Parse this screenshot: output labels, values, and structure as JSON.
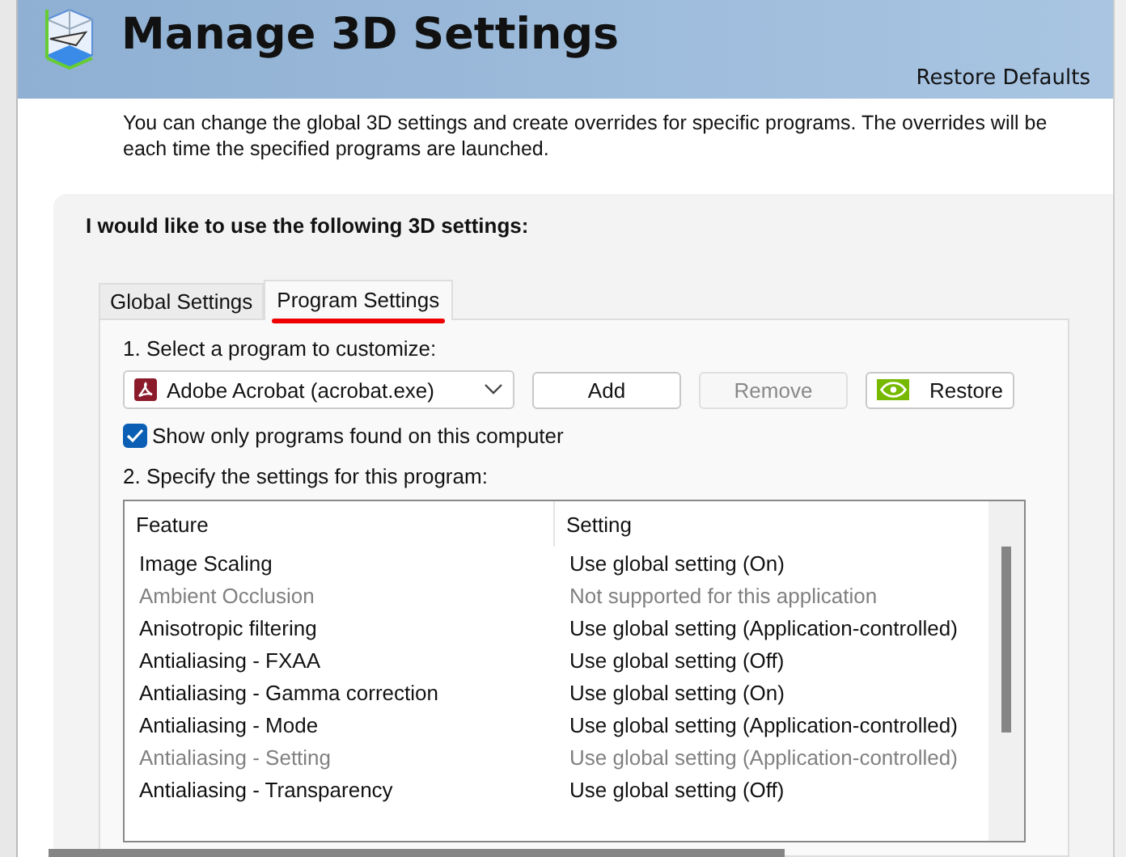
{
  "header": {
    "title": "Manage 3D Settings",
    "restore_link": "Restore Defaults"
  },
  "description": [
    "You can change the global 3D settings and create overrides for specific programs. The overrides will be",
    "each time the specified programs are launched."
  ],
  "panel": {
    "title": "I would like to use the following 3D settings:",
    "tabs": [
      {
        "label": "Global Settings",
        "selected": false,
        "underlined": false
      },
      {
        "label": "Program Settings",
        "selected": true,
        "underlined": true
      }
    ],
    "step1": "1. Select a program to customize:",
    "program": "Adobe Acrobat (acrobat.exe)",
    "buttons": [
      {
        "label": "Add",
        "disabled": false,
        "kind": "plain"
      },
      {
        "label": "Remove",
        "disabled": true,
        "kind": "plain"
      },
      {
        "label": "Restore",
        "disabled": false,
        "kind": "logo"
      }
    ],
    "show_only": {
      "label": "Show only programs found on this computer",
      "checked": true
    },
    "step2": "2. Specify the settings for this program:",
    "table": {
      "columns": [
        "Feature",
        "Setting"
      ],
      "rows": [
        {
          "feature": "Image Scaling",
          "setting": "Use global setting (On)",
          "disabled": false
        },
        {
          "feature": "Ambient Occlusion",
          "setting": "Not supported for this application",
          "disabled": true
        },
        {
          "feature": "Anisotropic filtering",
          "setting": "Use global setting (Application-controlled)",
          "disabled": false
        },
        {
          "feature": "Antialiasing - FXAA",
          "setting": "Use global setting (Off)",
          "disabled": false
        },
        {
          "feature": "Antialiasing - Gamma correction",
          "setting": "Use global setting (On)",
          "disabled": false
        },
        {
          "feature": "Antialiasing - Mode",
          "setting": "Use global setting (Application-controlled)",
          "disabled": false
        },
        {
          "feature": "Antialiasing - Setting",
          "setting": "Use global setting (Application-controlled)",
          "disabled": true
        },
        {
          "feature": "Antialiasing - Transparency",
          "setting": "Use global setting (Off)",
          "disabled": false
        }
      ]
    }
  }
}
